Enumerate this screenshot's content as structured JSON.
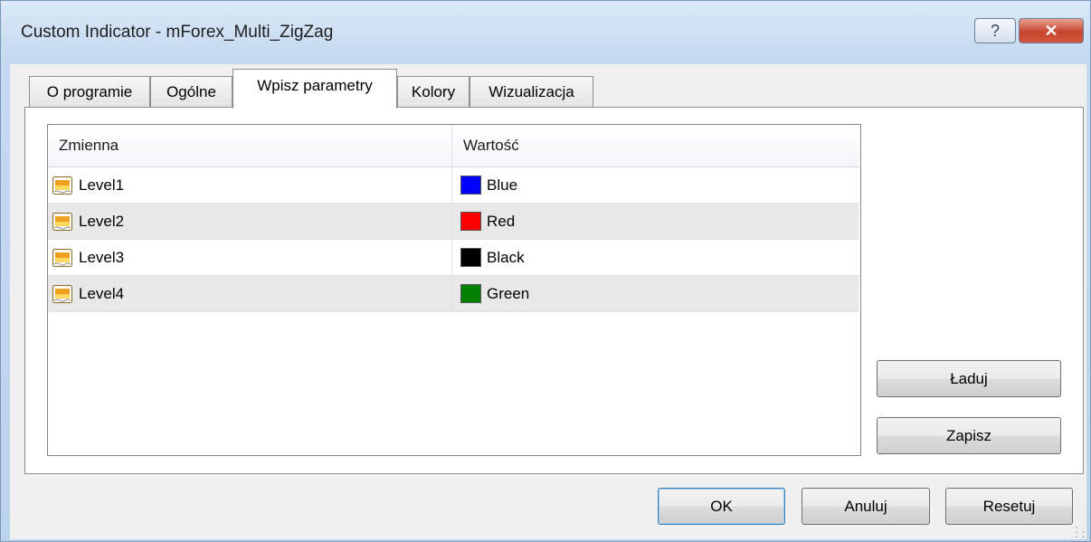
{
  "window": {
    "title": "Custom Indicator - mForex_Multi_ZigZag",
    "help_label": "?",
    "close_label": "✕"
  },
  "tabs": [
    {
      "label": "O programie",
      "active": false
    },
    {
      "label": "Ogólne",
      "active": false
    },
    {
      "label": "Wpisz parametry",
      "active": true
    },
    {
      "label": "Kolory",
      "active": false
    },
    {
      "label": "Wizualizacja",
      "active": false
    }
  ],
  "grid": {
    "headers": {
      "variable": "Zmienna",
      "value": "Wartość"
    },
    "rows": [
      {
        "name": "Level1",
        "value": "Blue",
        "color": "#0000ff"
      },
      {
        "name": "Level2",
        "value": "Red",
        "color": "#ff0000"
      },
      {
        "name": "Level3",
        "value": "Black",
        "color": "#000000"
      },
      {
        "name": "Level4",
        "value": "Green",
        "color": "#008000"
      }
    ]
  },
  "side_buttons": {
    "load": "Ładuj",
    "save": "Zapisz"
  },
  "footer_buttons": {
    "ok": "OK",
    "cancel": "Anuluj",
    "reset": "Resetuj"
  }
}
